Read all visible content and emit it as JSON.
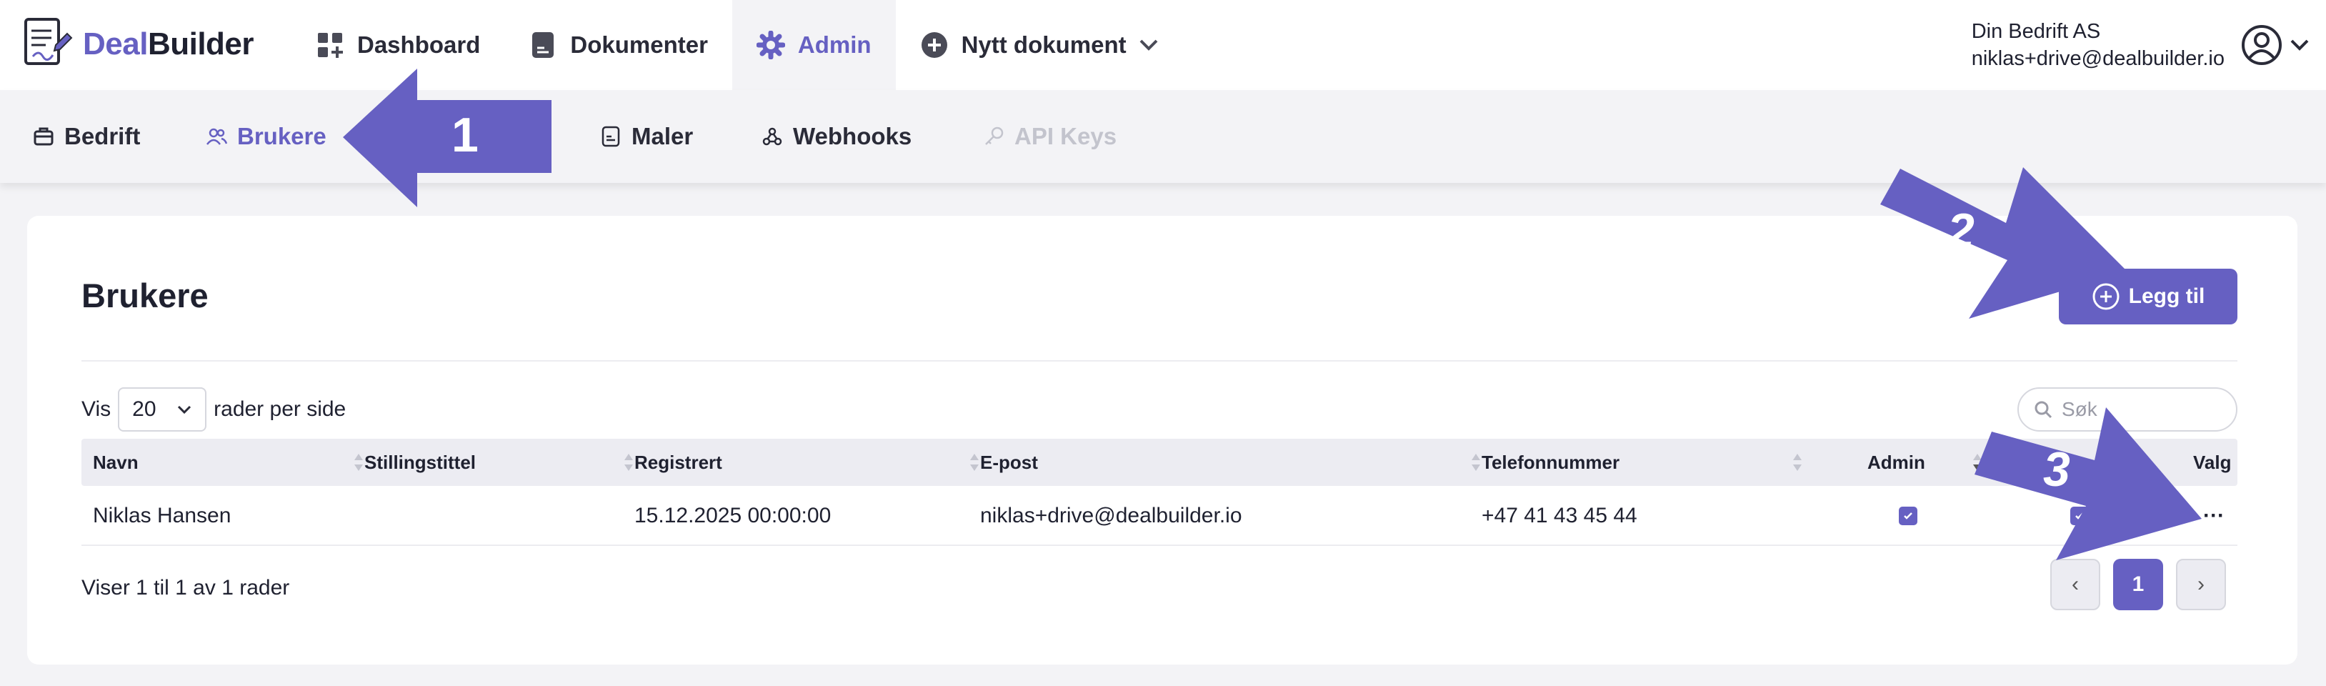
{
  "brand": {
    "part1": "Deal",
    "part2": "Builder"
  },
  "nav": {
    "items": [
      {
        "label": "Dashboard",
        "icon": "dashboard-icon"
      },
      {
        "label": "Dokumenter",
        "icon": "document-icon"
      },
      {
        "label": "Admin",
        "icon": "gear-icon",
        "active": true
      },
      {
        "label": "Nytt dokument",
        "icon": "plus-circle-icon"
      }
    ]
  },
  "account": {
    "company": "Din Bedrift AS",
    "email": "niklas+drive@dealbuilder.io"
  },
  "subnav": {
    "items": [
      {
        "label": "Bedrift",
        "icon": "briefcase-icon"
      },
      {
        "label": "Brukere",
        "icon": "users-icon",
        "active": true
      },
      {
        "label": "Maler",
        "icon": "template-icon"
      },
      {
        "label": "Webhooks",
        "icon": "webhook-icon"
      },
      {
        "label": "API Keys",
        "icon": "key-icon",
        "disabled": true
      }
    ]
  },
  "page": {
    "title": "Brukere",
    "add_label": "Legg til",
    "show_prefix": "Vis",
    "page_size": "20",
    "show_suffix": "rader per side",
    "search_placeholder": "Søk",
    "footer_info": "Viser 1 til 1 av 1 rader"
  },
  "table": {
    "columns": [
      "Navn",
      "Stillingstittel",
      "Registrert",
      "E-post",
      "Telefonnummer",
      "Admin",
      "Valg"
    ],
    "rows": [
      {
        "name": "Niklas Hansen",
        "title": "",
        "registered": "15.12.2025 00:00:00",
        "email": "niklas+drive@dealbuilder.io",
        "phone": "+47 41 43 45 44",
        "admin": true,
        "active": true,
        "options": "···"
      }
    ]
  },
  "pagination": {
    "prev": "‹",
    "current": "1",
    "next": "›"
  },
  "annotations": {
    "a1": "1",
    "a2": "2",
    "a3": "3"
  },
  "colors": {
    "accent": "#6660c2",
    "arrow": "#6660c2",
    "background": "#f3f3f6"
  }
}
